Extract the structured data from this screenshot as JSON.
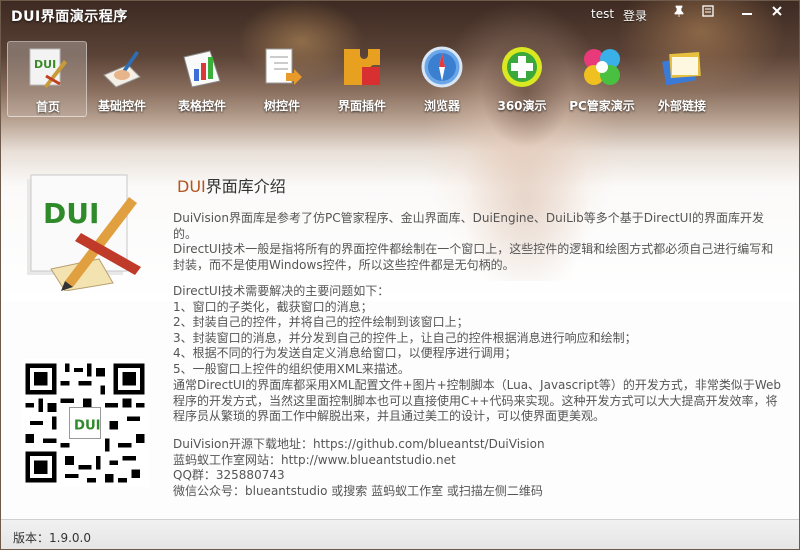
{
  "window": {
    "title": "DUI界面演示程序",
    "user": "test",
    "login_label": "登录",
    "controls": [
      "pin-icon",
      "skin-icon",
      "minimize-icon",
      "close-icon"
    ]
  },
  "toolbar": {
    "tabs": [
      {
        "label": "首页",
        "icon": "dui-home-icon",
        "active": true
      },
      {
        "label": "基础控件",
        "icon": "writing-hand-icon"
      },
      {
        "label": "表格控件",
        "icon": "bar-chart-icon"
      },
      {
        "label": "树控件",
        "icon": "document-tree-icon"
      },
      {
        "label": "界面插件",
        "icon": "puzzle-icon"
      },
      {
        "label": "浏览器",
        "icon": "compass-browser-icon"
      },
      {
        "label": "360演示",
        "icon": "plus-circle-icon"
      },
      {
        "label": "PC管家演示",
        "icon": "clover-icon"
      },
      {
        "label": "外部链接",
        "icon": "stacked-books-icon"
      }
    ]
  },
  "content": {
    "title_highlight": "DUI",
    "title_rest": "界面库介绍",
    "paragraph1": "DuiVision界面库是参考了仿PC管家程序、金山界面库、DuiEngine、DuiLib等多个基于DirectUI的界面库开发的。",
    "paragraph2": "DirectUI技术一般是指将所有的界面控件都绘制在一个窗口上，这些控件的逻辑和绘图方式都必须自己进行编写和封装，而不是使用Windows控件，所以这些控件都是无句柄的。",
    "list_intro": "DirectUI技术需要解决的主要问题如下：",
    "list": [
      "1、窗口的子类化，截获窗口的消息；",
      "2、封装自己的控件，并将自己的控件绘制到该窗口上；",
      "3、封装窗口的消息，并分发到自己的控件上，让自己的控件根据消息进行响应和绘制；",
      "4、根据不同的行为发送自定义消息给窗口，以便程序进行调用；",
      "5、一般窗口上控件的组织使用XML来描述。"
    ],
    "paragraph3": "通常DirectUI的界面库都采用XML配置文件+图片+控制脚本（Lua、Javascript等）的开发方式，非常类似于Web程序的开发方式，当然这里面控制脚本也可以直接使用C++代码来实现。这种开发方式可以大大提高开发效率，将程序员从繁琐的界面工作中解脱出来，并且通过美工的设计，可以使界面更美观。",
    "links": [
      "DuiVision开源下载地址：https://github.com/blueantst/DuiVision",
      "蓝蚂蚁工作室网站：http://www.blueantstudio.net",
      "QQ群：325880743",
      "微信公众号：blueantstudio 或搜索 蓝蚂蚁工作室 或扫描左侧二维码"
    ],
    "big_icon_text": "DUI"
  },
  "statusbar": {
    "version": "版本：1.9.0.0"
  }
}
